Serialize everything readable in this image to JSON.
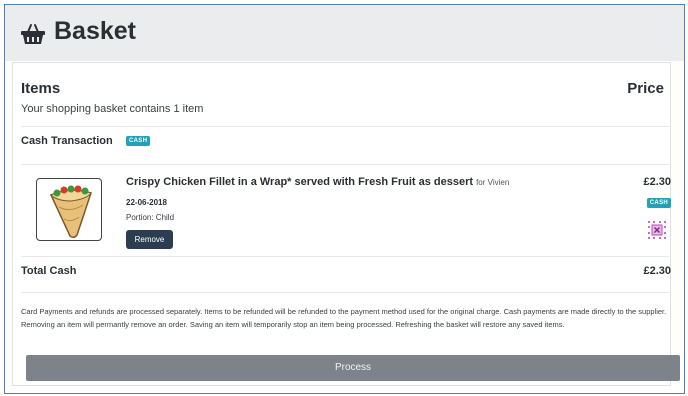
{
  "header": {
    "title": "Basket",
    "icon": "basket-icon"
  },
  "items_section": {
    "title": "Items",
    "price_header": "Price",
    "summary": "Your shopping basket contains 1 item"
  },
  "transaction": {
    "title": "Cash Transaction",
    "badge": "CASH"
  },
  "line_item": {
    "name": "Crispy Chicken Fillet in a Wrap* served with Fresh Fruit as dessert",
    "for_label": "for Vivien",
    "date": "22-06-2018",
    "portion": "Portion: Child",
    "remove_label": "Remove",
    "price": "£2.30",
    "badge": "CASH",
    "image_icon": "wrap-icon",
    "save_icon": "save-toggle-icon"
  },
  "totals": {
    "label": "Total Cash",
    "value": "£2.30"
  },
  "note": "Card Payments and refunds are processed separately. Items to be refunded will be refunded to the payment method used for the original charge. Cash payments are made directly to the supplier. Removing an item will permantly remove an order. Saving an item will temporarily stop an item being processed. Refreshing the basket will restore any saved items.",
  "process_label": "Process",
  "colors": {
    "badge": "#21a2b8",
    "remove_button": "#2c3d52",
    "process_button": "#7d8389",
    "header_bg": "#ebecee",
    "frame_border": "#4a7fc1"
  }
}
